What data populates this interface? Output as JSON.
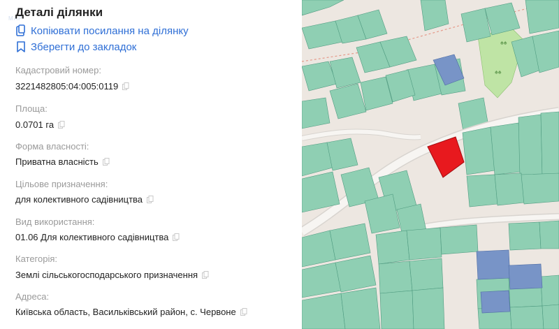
{
  "panel": {
    "title": "Деталі ділянки",
    "actions": {
      "copy_link": "Копіювати посилання на ділянку",
      "bookmark": "Зберегти до закладок"
    },
    "fields": [
      {
        "label": "Кадастровий номер:",
        "value": "3221482805:04:005:0119"
      },
      {
        "label": "Площа:",
        "value": "0.0701 га"
      },
      {
        "label": "Форма власності:",
        "value": "Приватна власність"
      },
      {
        "label": "Цільове призначення:",
        "value": "для колективного садівництва"
      },
      {
        "label": "Вид використання:",
        "value": "01.06 Для колективного садівництва"
      },
      {
        "label": "Категорія:",
        "value": "Землі сільськогосподарського призначення"
      },
      {
        "label": "Адреса:",
        "value": "Київська область, Васильківський район, с. Червоне"
      }
    ]
  },
  "colors": {
    "accent": "#2f6fd6",
    "parcel": "#8fcfb3",
    "parcel_stroke": "#4f9b80",
    "selected_parcel": "#e8191e",
    "bookmarked_parcel": "#7894c7",
    "green_area": "#bfe4a5",
    "road": "#f7f5f2",
    "map_bg": "#ede7e1"
  },
  "icons": {
    "copy_link": "clipboard-icon",
    "bookmark": "bookmark-icon",
    "copy_value": "copy-icon"
  }
}
